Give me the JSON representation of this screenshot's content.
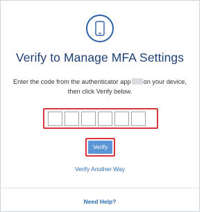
{
  "header": {
    "icon": "mobile-phone-icon",
    "title": "Verify to Manage MFA Settings"
  },
  "instructions": {
    "line1_before": "Enter the code from the authenticator app",
    "line1_after": "on your device,",
    "line2": "then click Verify below."
  },
  "code_inputs": {
    "count": 6,
    "values": [
      "",
      "",
      "",
      "",
      "",
      ""
    ]
  },
  "actions": {
    "verify_label": "Verify",
    "alternate_label": "Verify Another Way"
  },
  "footer": {
    "help_label": "Need Help?"
  },
  "colors": {
    "title": "#1e3f73",
    "icon": "#2b5fa8",
    "highlight": "#d9343c",
    "button": "#5b95d6",
    "link": "#2a6db5"
  }
}
